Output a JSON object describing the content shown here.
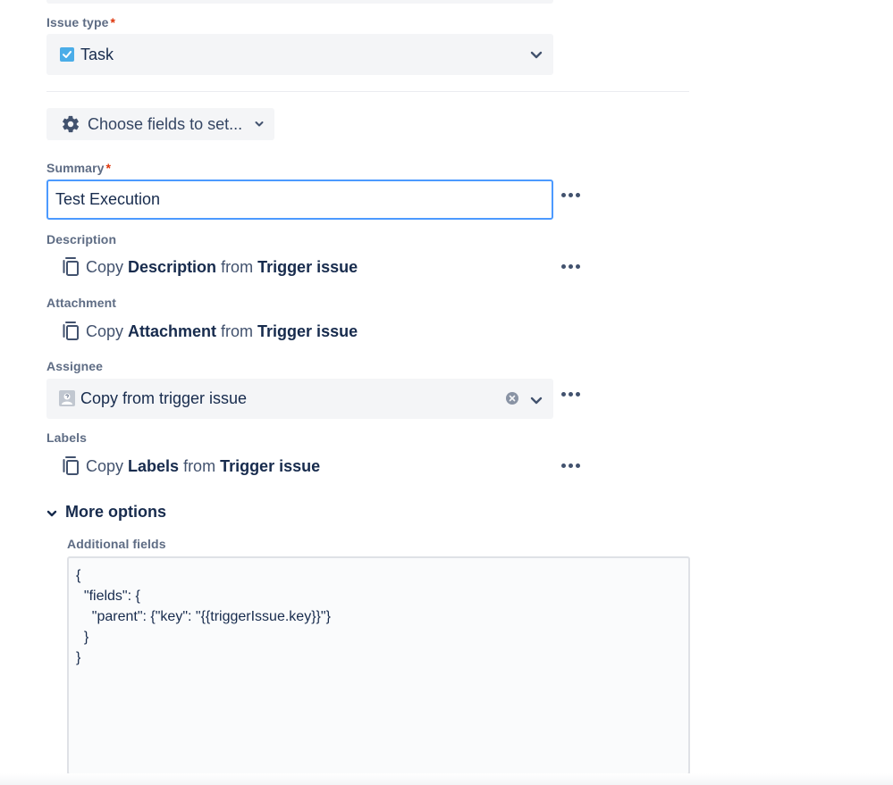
{
  "issue_type": {
    "label": "Issue type",
    "required_mark": "*",
    "value": "Task"
  },
  "choose_fields": {
    "label": "Choose fields to set..."
  },
  "summary": {
    "label": "Summary",
    "required_mark": "*",
    "value": "Test Execution"
  },
  "description": {
    "label": "Description",
    "copy_word": "Copy",
    "field": "Description",
    "from_word": "from",
    "source": "Trigger issue"
  },
  "attachment": {
    "label": "Attachment",
    "copy_word": "Copy",
    "field": "Attachment",
    "from_word": "from",
    "source": "Trigger issue"
  },
  "assignee": {
    "label": "Assignee",
    "value": "Copy from trigger issue"
  },
  "labels": {
    "label": "Labels",
    "copy_word": "Copy",
    "field": "Labels",
    "from_word": "from",
    "source": "Trigger issue"
  },
  "more_options": {
    "label": "More options",
    "additional_fields_label": "Additional fields",
    "additional_fields_value": "{\n  \"fields\": {\n    \"parent\": {\"key\": \"{{triggerIssue.key}}\"}\n  }\n}"
  },
  "colors": {
    "accent": "#4c9aff",
    "required": "#de350b",
    "checkbox": "#2684ff"
  },
  "icons": [
    "task-checkbox-icon",
    "chevron-down-icon",
    "gear-icon",
    "copy-icon",
    "more-icon",
    "avatar-icon",
    "clear-icon"
  ]
}
